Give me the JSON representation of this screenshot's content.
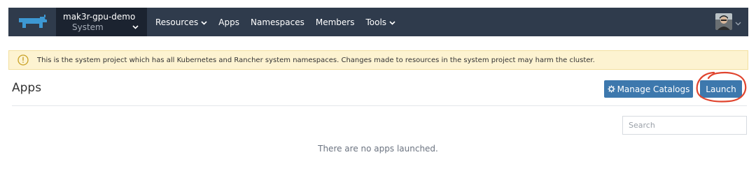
{
  "topbar": {
    "logo_icon": "rancher-cow-logo-icon",
    "project": {
      "name": "mak3r-gpu-demo",
      "cluster_label": "System"
    },
    "nav": [
      {
        "label": "Resources",
        "has_dropdown": true
      },
      {
        "label": "Apps",
        "has_dropdown": false
      },
      {
        "label": "Namespaces",
        "has_dropdown": false
      },
      {
        "label": "Members",
        "has_dropdown": false
      },
      {
        "label": "Tools",
        "has_dropdown": true
      }
    ],
    "user_icon": "user-avatar"
  },
  "banner": {
    "icon": "info-icon",
    "text": "This is the system project which has all Kubernetes and Rancher system namespaces. Changes made to resources in the system project may harm the cluster."
  },
  "header": {
    "title": "Apps",
    "manage_catalogs_label": "Manage Catalogs",
    "launch_label": "Launch"
  },
  "search": {
    "placeholder": "Search",
    "value": ""
  },
  "empty_state": "There are no apps launched.",
  "colors": {
    "topbar": "#2f3b4c",
    "project_switcher": "#1b2330",
    "primary_button": "#3d78ad",
    "banner_bg": "#fdf3d1",
    "annotation": "#e0452f"
  }
}
